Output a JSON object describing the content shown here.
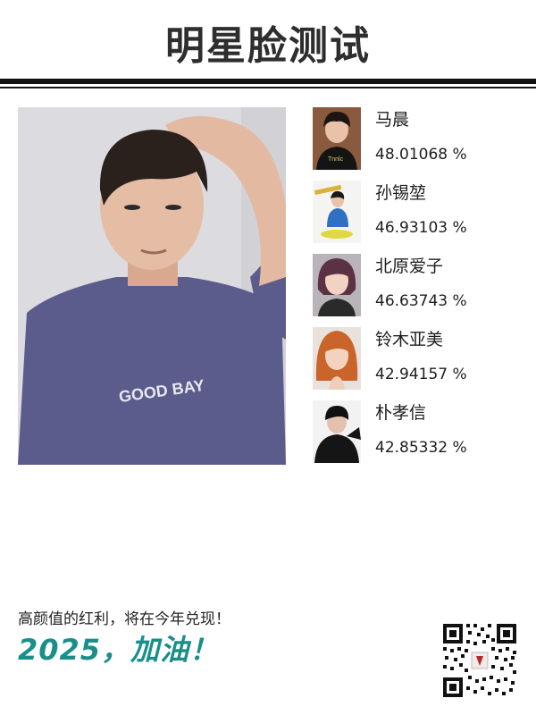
{
  "header": {
    "title": "明星脸测试"
  },
  "photo": {
    "shirt_text": "GOOD BAY",
    "shirt_color": "#5a5a8a"
  },
  "matches": [
    {
      "name": "马晨",
      "score": "48.01068 %",
      "thumb_tone": "#3b2a22"
    },
    {
      "name": "孙锡堃",
      "score": "46.93103 %",
      "thumb_tone": "#2d6fc2"
    },
    {
      "name": "北原爱子",
      "score": "46.63743 %",
      "thumb_tone": "#6b3a4a"
    },
    {
      "name": "铃木亚美",
      "score": "42.94157 %",
      "thumb_tone": "#c7682c"
    },
    {
      "name": "朴孝信",
      "score": "42.85332 %",
      "thumb_tone": "#1b1b1b"
    }
  ],
  "footer": {
    "line1": "高颜值的红利，将在今年兑现！",
    "slogan": "2025，加油！",
    "accent": "#1a8f8a"
  }
}
